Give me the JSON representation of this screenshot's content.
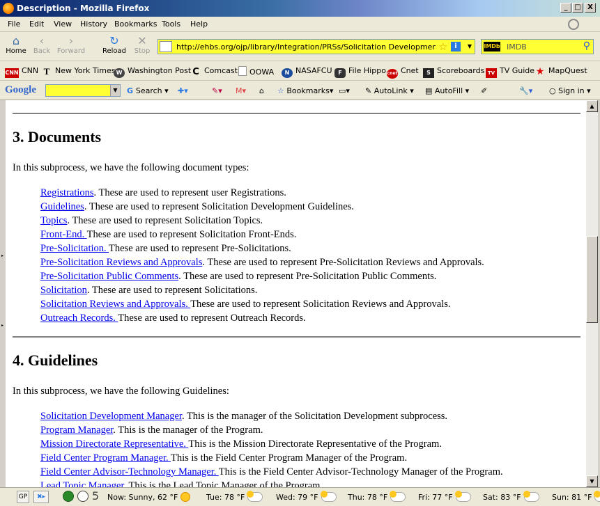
{
  "window": {
    "title": "Description - Mozilla Firefox",
    "controls": [
      "_",
      "□",
      "X"
    ]
  },
  "menu": [
    {
      "label": "File"
    },
    {
      "label": "Edit"
    },
    {
      "label": "View"
    },
    {
      "label": "History"
    },
    {
      "label": "Bookmarks"
    },
    {
      "label": "Tools"
    },
    {
      "label": "Help"
    }
  ],
  "nav": {
    "home": "Home",
    "back": "Back",
    "forward": "Forward",
    "reload": "Reload",
    "stop": "Stop",
    "url": "http://ehbs.org/ojp/library/Integration/PRSs/Solicitation Development/Descri",
    "search_engine_badge": "IMDb",
    "search_placeholder": "IMDB"
  },
  "bookmarks": [
    {
      "label": "CNN",
      "icon": "cnn-icon",
      "badge": "CNN"
    },
    {
      "label": "New York Times",
      "icon": "nyt-icon",
      "badge": "T"
    },
    {
      "label": "Washington Post",
      "icon": "wapo-icon",
      "badge": "W"
    },
    {
      "label": "Comcast",
      "icon": "comcast-icon",
      "badge": "C"
    },
    {
      "label": "OOWA",
      "icon": "page-icon",
      "badge": ""
    },
    {
      "label": "NASAFCU",
      "icon": "nasa-icon",
      "badge": "N"
    },
    {
      "label": "File Hippo",
      "icon": "hippo-icon",
      "badge": "F"
    },
    {
      "label": "Cnet",
      "icon": "cnet-icon",
      "badge": "cnet"
    },
    {
      "label": "Scoreboards",
      "icon": "scoreboards-icon",
      "badge": "S"
    },
    {
      "label": "TV Guide",
      "icon": "tvguide-icon",
      "badge": "TV"
    },
    {
      "label": "MapQuest",
      "icon": "mapquest-icon",
      "badge": "★"
    }
  ],
  "google_toolbar": {
    "logo": "Google",
    "search": "Search",
    "bookmarks": "Bookmarks",
    "autolink": "AutoLink",
    "autofill": "AutoFill",
    "signin": "Sign in"
  },
  "sections": [
    {
      "heading": "3. Documents",
      "intro": "In this subprocess, we have the following document types:",
      "items": [
        {
          "link": "Registrations",
          "text": ". These are used to represent user Registrations."
        },
        {
          "link": "Guidelines",
          "text": ". These are used to represent Solicitation Development Guidelines."
        },
        {
          "link": "Topics",
          "text": ". These are used to represent Solicitation Topics."
        },
        {
          "link": "Front-End. ",
          "text": "These are used to represent Solicitation Front-Ends."
        },
        {
          "link": "Pre-Solicitation. ",
          "text": "These are used to represent Pre-Solicitations."
        },
        {
          "link": "Pre-Solicitation Reviews and Approvals",
          "text": ". These are used to represent Pre-Solicitation Reviews and Approvals."
        },
        {
          "link": "Pre-Solicitation Public Comments",
          "text": ". These are used to represent Pre-Solicitation Public Comments."
        },
        {
          "link": "Solicitation",
          "text": ". These are used to represent Solicitations."
        },
        {
          "link": "Solicitation Reviews and Approvals. ",
          "text": "These are used to represent Solicitation Reviews and Approvals."
        },
        {
          "link": "Outreach Records. ",
          "text": "These are used to represent Outreach Records."
        }
      ]
    },
    {
      "heading": "4. Guidelines",
      "intro": "In this subprocess, we have the following Guidelines:",
      "items": [
        {
          "link": "Solicitation Development Manager",
          "text": ". This is the manager of the Solicitation Development subprocess."
        },
        {
          "link": "Program Manager",
          "text": ". This is the manager of the Program."
        },
        {
          "link": "Mission Directorate Representative. ",
          "text": "This is the Mission Directorate Representative of the Program."
        },
        {
          "link": "Field Center Program Manager. ",
          "text": "This is the Field Center Program Manager of the Program."
        },
        {
          "link": "Field Center Advisor-Technology Manager. ",
          "text": "This is the Field Center Advisor-Technology Manager of the Program."
        },
        {
          "link": "Lead Topic Manager",
          "text": ". This is the Lead Topic Manager of the Program."
        }
      ]
    }
  ],
  "status": {
    "gp": "GP",
    "count": "5",
    "weather": [
      {
        "label": "Now: Sunny, 62 °F",
        "icon": "sun-icon"
      },
      {
        "label": "Tue: 78 °F",
        "icon": "partly-cloudy-icon"
      },
      {
        "label": "Wed: 79 °F",
        "icon": "partly-cloudy-icon"
      },
      {
        "label": "Thu: 78 °F",
        "icon": "partly-cloudy-icon"
      },
      {
        "label": "Fri: 77 °F",
        "icon": "partly-cloudy-icon"
      },
      {
        "label": "Sat: 83 °F",
        "icon": "partly-cloudy-icon"
      },
      {
        "label": "Sun: 81 °F",
        "icon": "partly-cloudy-icon"
      }
    ]
  }
}
